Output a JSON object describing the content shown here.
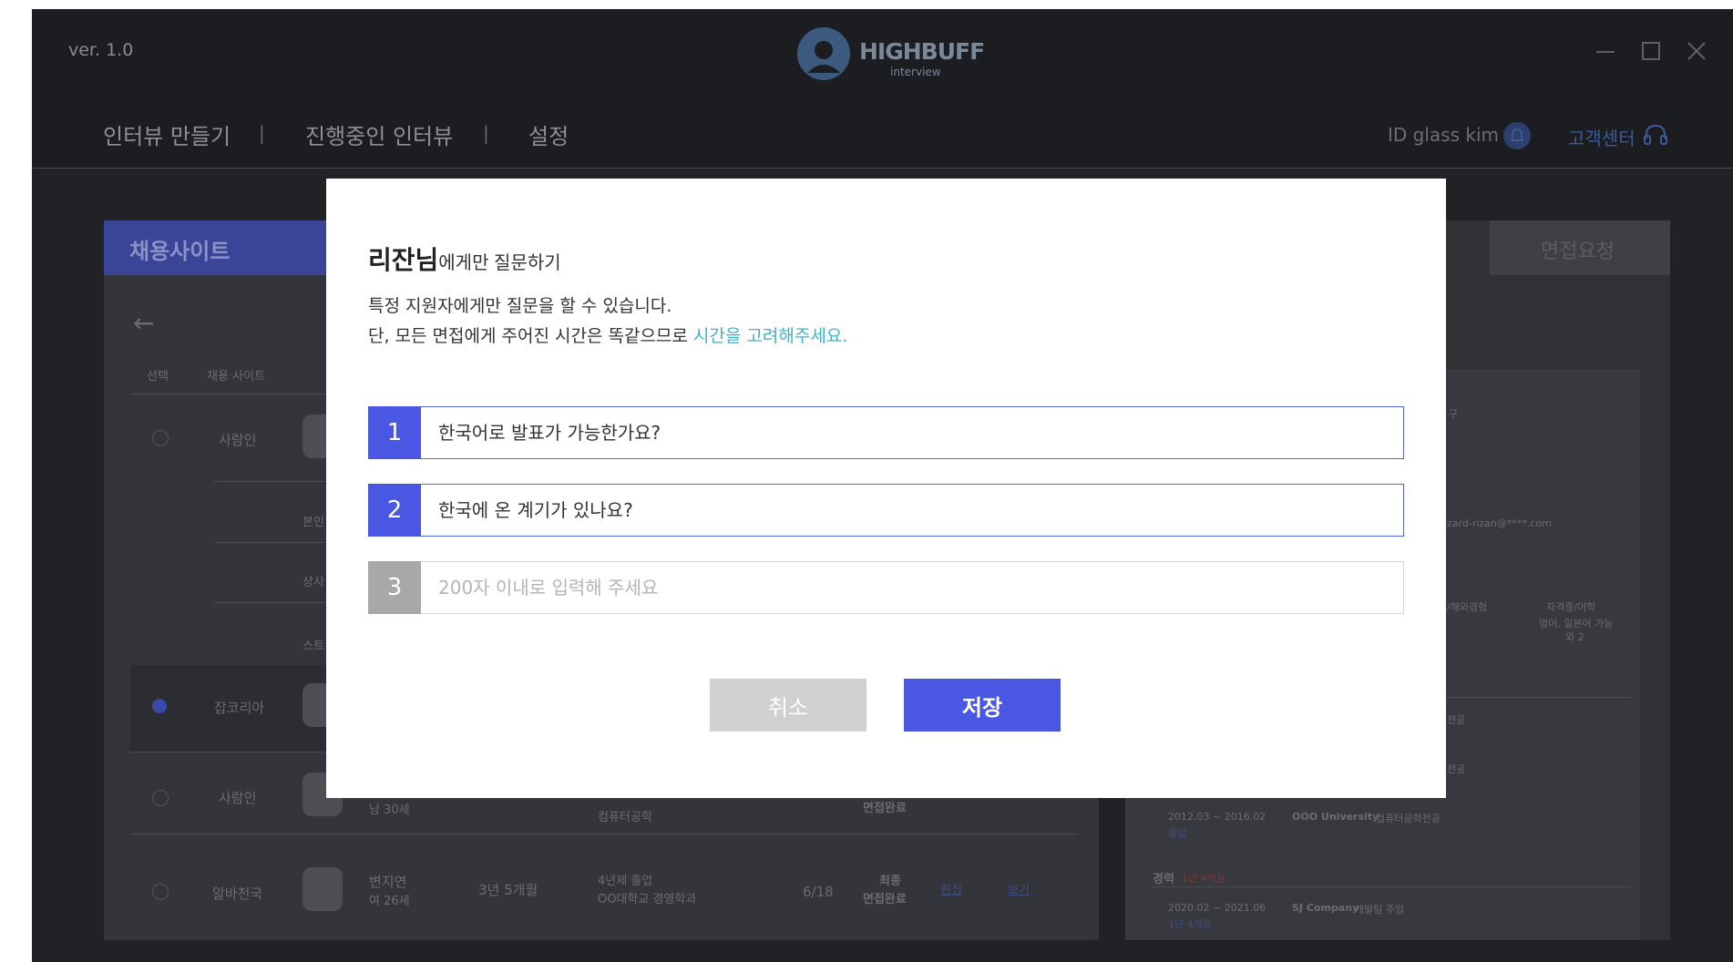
{
  "app": {
    "version": "ver. 1.0",
    "logo_text": "HIGHBUFF",
    "logo_sub": "interview"
  },
  "nav": {
    "items": [
      "인터뷰 만들기",
      "진행중인 인터뷰",
      "설정"
    ],
    "separator": "|",
    "user_id": "ID  glass kim",
    "support": "고객센터"
  },
  "background": {
    "left_title": "채용사이트",
    "right_tab": "면접요청",
    "table_headers": [
      "선택",
      "채용 사이트"
    ],
    "rows": [
      {
        "site": "사람인"
      },
      {
        "site": "잡코리아"
      },
      {
        "site": "사람인",
        "age": "남 30세",
        "edu": "컴퓨터공학",
        "status": "면접완료"
      },
      {
        "site": "알바천국",
        "name": "변지연",
        "age": "여 26세",
        "career": "3년 5개월",
        "edu1": "4년제 졸업",
        "edu2": "OO대학교 경영학과",
        "count": "6/18",
        "status1": "최종",
        "status2": "면접완료",
        "edit": "편집",
        "view": "보기"
      }
    ],
    "row_labels": [
      "본인",
      "상사",
      "스트"
    ],
    "right_texts": {
      "email": "zard-rizan@****.com",
      "cert": "자격증/어학",
      "cert_detail1": "영어, 일본어 가능",
      "cert_detail2": "외 2",
      "edu_period": "2012.03 ~ 2016.02",
      "edu_status": "졸업",
      "university": "OOO University",
      "major": "컴퓨터공학전공",
      "career_label": "경력",
      "career_len": "1년 4개월",
      "job_period": "2020.02 ~ 2021.06",
      "job_len": "1년 4개월",
      "company": "SJ Company",
      "dept": "개발팀 주임",
      "misc1": "구",
      "misc2": "/해외경험",
      "misc3": "전공",
      "misc4": "전공"
    }
  },
  "modal": {
    "title_name": "리잔님",
    "title_rest": "에게만 질문하기",
    "desc1": "특정 지원자에게만 질문을 할 수 있습니다.",
    "desc2_prefix": "단, 모든 면접에게 주어진 시간은 똑같으므로 ",
    "desc2_accent": "시간을 고려해주세요.",
    "questions": [
      {
        "num": "1",
        "value": "한국어로 발표가 가능한가요?"
      },
      {
        "num": "2",
        "value": "한국에 온 계기가 있나요?"
      },
      {
        "num": "3",
        "value": "",
        "placeholder": "200자 이내로 입력해 주세요"
      }
    ],
    "cancel_label": "취소",
    "save_label": "저장"
  },
  "colors": {
    "accent": "#4a57e2",
    "link": "#3ab4c8",
    "disabled": "#d0d0d0"
  }
}
